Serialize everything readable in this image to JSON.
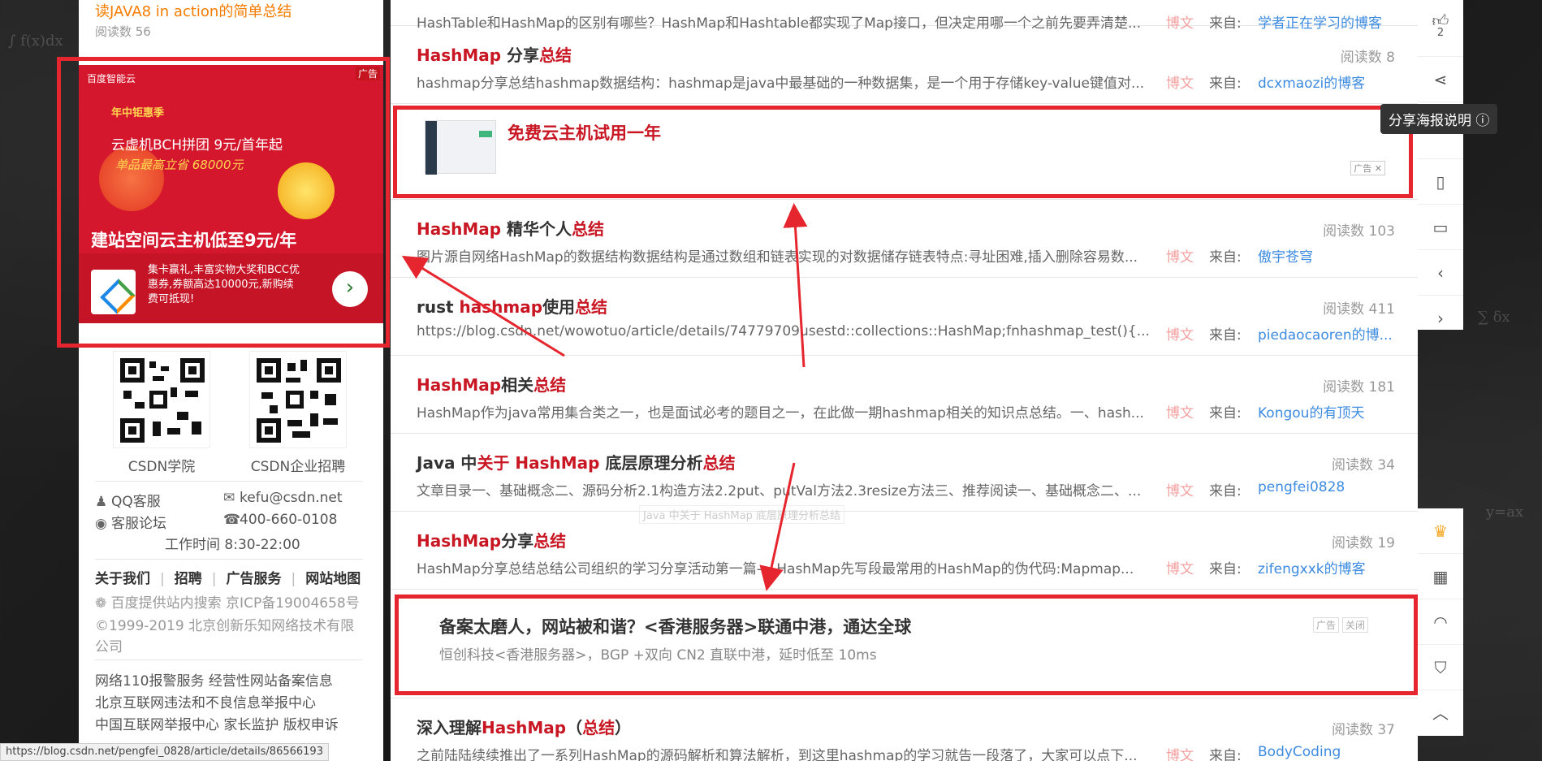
{
  "left": {
    "top_item": {
      "title": "读JAVA8 in action的简单总结",
      "reads": "阅读数 56"
    },
    "ad": {
      "brand": "百度智能云",
      "ad_tag": "广告",
      "promo": "年中钜惠季",
      "line1": "云虚机BCH拼团 9元/首年起",
      "line2": "单品最高立省 68000元",
      "big": "建站空间云主机低至9元/年",
      "desc": "集卡赢礼,丰富实物大奖和BCC优惠券,券额高达10000元,新购续费可抵现!",
      "go": "›"
    },
    "qr": [
      {
        "label": "CSDN学院",
        "icon": "qr-code"
      },
      {
        "label": "CSDN企业招聘",
        "icon": "qr-code"
      }
    ],
    "contacts": {
      "qq": "QQ客服",
      "email": "kefu@csdn.net",
      "forum": "客服论坛",
      "phone": "400-660-0108",
      "hours": "工作时间 8:30-22:00"
    },
    "links": [
      "关于我们",
      "招聘",
      "广告服务",
      "网站地图"
    ],
    "beian": "百度提供站内搜索 京ICP备19004658号",
    "copyright1": "©1999-2019 北京创新乐知网络技术有限",
    "copyright2": "公司",
    "footer1": "网络110报警服务    经营性网站备案信息",
    "footer2": "北京互联网违法和不良信息举报中心",
    "footer3": "中国互联网举报中心  家长监护  版权申诉"
  },
  "list": {
    "partial_top": {
      "desc": "HashTable和HashMap的区别有哪些？HashMap和Hashtable都实现了Map接口，但决定用哪一个之前先要弄清楚...",
      "type": "博文",
      "from": "来自:",
      "author": "学者正在学习的博客"
    },
    "items": [
      {
        "title_pre": "",
        "hl1": "HashMap",
        "mid": " 分享",
        "hl2": "总结",
        "post": "",
        "reads": "阅读数 8",
        "desc": "hashmap分享总结hashmap数据结构：hashmap是java中最基础的一种数据集，是一个用于存储key-value键值对...",
        "type": "博文",
        "from": "来自:",
        "author": "dcxmaozi的博客"
      },
      {
        "title_pre": "",
        "hl1": "HashMap",
        "mid": " 精华个人",
        "hl2": "总结",
        "post": "",
        "reads": "阅读数 103",
        "desc": "图片源自网络HashMap的数据结构数据结构是通过数组和链表实现的对数据储存链表特点:寻址困难,插入删除容易数...",
        "type": "博文",
        "from": "来自:",
        "author": "傲宇苍穹"
      },
      {
        "title_pre": "rust ",
        "hl1": "hashmap",
        "mid": "使用",
        "hl2": "总结",
        "post": "",
        "reads": "阅读数 411",
        "desc": "https://blog.csdn.net/wowotuo/article/details/74779709usestd::collections::HashMap;fnhashmap_test(){...",
        "type": "博文",
        "from": "来自:",
        "author": "piedaocaoren的博..."
      },
      {
        "title_pre": "",
        "hl1": "HashMap",
        "mid": "相关",
        "hl2": "总结",
        "post": "",
        "reads": "阅读数 181",
        "desc": "HashMap作为java常用集合类之一，也是面试必考的题目之一，在此做一期hashmap相关的知识点总结。一、hash...",
        "type": "博文",
        "from": "来自:",
        "author": "Kongou的有顶天"
      },
      {
        "title_pre": "Java 中",
        "hl1": "关于 HashMap",
        "mid": " 底层原理分析",
        "hl2": "总结",
        "post": "",
        "reads": "阅读数 34",
        "desc": "文章目录一、基础概念二、源码分析2.1构造方法2.2put、putVal方法2.3resize方法三、推荐阅读一、基础概念二、...",
        "type": "博文",
        "from": "来自:",
        "author": "pengfei0828"
      },
      {
        "title_pre": "",
        "hl1": "HashMap",
        "mid": "分享",
        "hl2": "总结",
        "post": "",
        "reads": "阅读数 19",
        "desc": "HashMap分享总结总结公司组织的学习分享活动第一篇----HashMap先写段最常用的HashMap的伪代码:Mapmap...",
        "type": "博文",
        "from": "来自:",
        "author": "zifengxxk的博客"
      },
      {
        "title_pre": "深入理解",
        "hl1": "HashMap",
        "mid": "（",
        "hl2": "总结",
        "post": "）",
        "reads": "阅读数 37",
        "desc": "之前陆陆续续推出了一系列HashMap的源码解析和算法解析，到这里hashmap的学习就告一段落了，大家可以点下...",
        "type": "博文",
        "from": "来自:",
        "author": "BodyCoding"
      }
    ],
    "ad_mid": {
      "title": "免费云主机试用一年",
      "tag": "广告 ✕"
    },
    "ad_bottom": {
      "title": "备案太磨人，网站被和谐？<香港服务器>联通中港，通达全球",
      "desc": "恒创科技<香港服务器>，BGP +双向 CN2 直联中港，延时低至 10ms",
      "tag1": "广告",
      "tag2": "关闭"
    }
  },
  "toolbar": {
    "like_count": "2",
    "tooltip": "分享海报说明 ⓘ",
    "icons": [
      "thumbs-up-icon",
      "share-icon",
      "bookmark-icon",
      "mobile-icon",
      "chevron-left-icon",
      "chevron-right-icon"
    ],
    "icons2": [
      "crown-icon",
      "qr-code-icon",
      "headset-icon",
      "report-icon",
      "chevron-up-icon"
    ]
  },
  "watermark": "Java 中关于 HashMap 底层原理分析总结",
  "status_url": "https://blog.csdn.net/pengfei_0828/article/details/86566193",
  "colors": {
    "highlight": "#c81623",
    "annotation": "#e6262e",
    "link": "#3d8be0"
  }
}
